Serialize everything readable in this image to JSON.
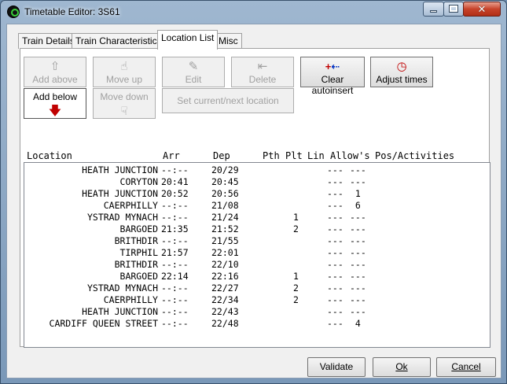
{
  "window": {
    "title": "Timetable Editor: 3S61"
  },
  "tabs": [
    {
      "label": "Train Details",
      "active": false
    },
    {
      "label": "Train Characteristics",
      "active": false
    },
    {
      "label": "Location List",
      "active": true
    },
    {
      "label": "Misc",
      "active": false
    }
  ],
  "toolbar": {
    "add_above": "Add above",
    "add_below": "Add below",
    "move_up": "Move up",
    "move_down": "Move down",
    "edit": "Edit",
    "delete": "Delete",
    "set_current": "Set current/next location",
    "clear_autoinsert": "Clear autoinsert",
    "adjust_times": "Adjust times"
  },
  "icons": {
    "add_above": "up-arrow-icon",
    "add_below": "down-arrow-icon",
    "move_up": "hand-up-icon",
    "move_down": "hand-down-icon",
    "edit": "edit-icon",
    "delete": "delete-icon",
    "clear_autoinsert": "clear-icon",
    "adjust_times": "clock-icon"
  },
  "columns": {
    "location": "Location",
    "arr": "Arr",
    "dep": "Dep",
    "pth": "Pth",
    "plt": "Plt",
    "lin": "Lin",
    "allows": "Allow's",
    "pos": "Pos/Activities"
  },
  "rows": [
    {
      "loc": "HEATH JUNCTION",
      "arr": "--:--",
      "dep": "20/29",
      "plt": "",
      "allow1": "---",
      "allow2": "---"
    },
    {
      "loc": "CORYTON",
      "arr": "20:41",
      "dep": "20:45",
      "plt": "",
      "allow1": "---",
      "allow2": "---"
    },
    {
      "loc": "HEATH JUNCTION",
      "arr": "20:52",
      "dep": "20:56",
      "plt": "",
      "allow1": "---",
      "allow2": " 1"
    },
    {
      "loc": "CAERPHILLY",
      "arr": "--:--",
      "dep": "21/08",
      "plt": "",
      "allow1": "---",
      "allow2": " 6"
    },
    {
      "loc": "YSTRAD MYNACH",
      "arr": "--:--",
      "dep": "21/24",
      "plt": "1",
      "allow1": "---",
      "allow2": "---"
    },
    {
      "loc": "BARGOED",
      "arr": "21:35",
      "dep": "21:52",
      "plt": "2",
      "allow1": "---",
      "allow2": "---"
    },
    {
      "loc": "BRITHDIR",
      "arr": "--:--",
      "dep": "21/55",
      "plt": "",
      "allow1": "---",
      "allow2": "---"
    },
    {
      "loc": "TIRPHIL",
      "arr": "21:57",
      "dep": "22:01",
      "plt": "",
      "allow1": "---",
      "allow2": "---"
    },
    {
      "loc": "BRITHDIR",
      "arr": "--:--",
      "dep": "22/10",
      "plt": "",
      "allow1": "---",
      "allow2": "---"
    },
    {
      "loc": "BARGOED",
      "arr": "22:14",
      "dep": "22:16",
      "plt": "1",
      "allow1": "---",
      "allow2": "---"
    },
    {
      "loc": "YSTRAD MYNACH",
      "arr": "--:--",
      "dep": "22/27",
      "plt": "2",
      "allow1": "---",
      "allow2": "---"
    },
    {
      "loc": "CAERPHILLY",
      "arr": "--:--",
      "dep": "22/34",
      "plt": "2",
      "allow1": "---",
      "allow2": "---"
    },
    {
      "loc": "HEATH JUNCTION",
      "arr": "--:--",
      "dep": "22/43",
      "plt": "",
      "allow1": "---",
      "allow2": "---"
    },
    {
      "loc": "CARDIFF QUEEN STREET",
      "arr": "--:--",
      "dep": "22/48",
      "plt": "",
      "allow1": "---",
      "allow2": " 4"
    }
  ],
  "buttons": {
    "validate": "Validate",
    "ok": "Ok",
    "cancel": "Cancel"
  }
}
